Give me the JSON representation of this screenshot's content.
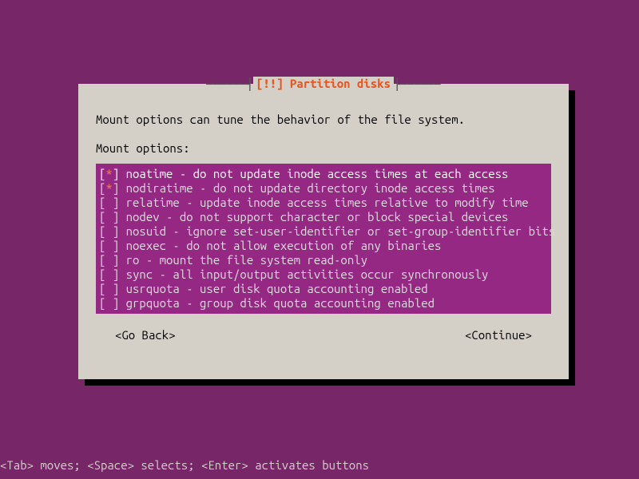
{
  "dialog": {
    "title": "[!!] Partition disks",
    "description": "Mount options can tune the behavior of the file system.",
    "prompt": "Mount options:",
    "options": [
      {
        "checked": true,
        "name": "noatime",
        "desc": "do not update inode access times at each access"
      },
      {
        "checked": true,
        "name": "nodiratime",
        "desc": "do not update directory inode access times"
      },
      {
        "checked": false,
        "name": "relatime",
        "desc": "update inode access times relative to modify time"
      },
      {
        "checked": false,
        "name": "nodev",
        "desc": "do not support character or block special devices"
      },
      {
        "checked": false,
        "name": "nosuid",
        "desc": "ignore set-user-identifier or set-group-identifier bits"
      },
      {
        "checked": false,
        "name": "noexec",
        "desc": "do not allow execution of any binaries"
      },
      {
        "checked": false,
        "name": "ro",
        "desc": "mount the file system read-only"
      },
      {
        "checked": false,
        "name": "sync",
        "desc": "all input/output activities occur synchronously"
      },
      {
        "checked": false,
        "name": "usrquota",
        "desc": "user disk quota accounting enabled"
      },
      {
        "checked": false,
        "name": "grpquota",
        "desc": "group disk quota accounting enabled"
      }
    ],
    "focused_index": 0,
    "go_back_label": "<Go Back>",
    "continue_label": "<Continue>"
  },
  "help_bar": "<Tab> moves; <Space> selects; <Enter> activates buttons",
  "colors": {
    "background": "#772768",
    "dialog_bg": "#d4d0c8",
    "options_bg": "#942882",
    "title_accent": "#e9541f"
  }
}
